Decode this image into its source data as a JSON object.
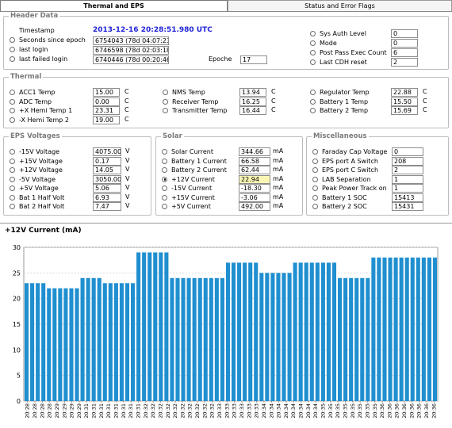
{
  "tabs": [
    {
      "label": "Thermal and EPS",
      "active": true
    },
    {
      "label": "Status and Error Flags",
      "active": false
    }
  ],
  "header": {
    "title": "Header Data",
    "timestamp_label": "Timestamp",
    "timestamp_value": "2013-12-16 20:28:51.980 UTC",
    "seconds_label": "Seconds since epoch",
    "seconds_value": "6754043 (78d 04:07:23)",
    "last_login_label": "last login",
    "last_login_value": "6746598 (78d 02:03:18)",
    "last_failed_label": "last failed login",
    "last_failed_value": "6740446 (78d 00:20:46)",
    "epoche_label": "Epoche",
    "epoche_value": "17",
    "sys_auth_label": "Sys Auth Level",
    "sys_auth_value": "0",
    "mode_label": "Mode",
    "mode_value": "0",
    "post_pass_label": "Post Pass Exec Count",
    "post_pass_value": "6",
    "last_cdh_label": "Last CDH reset",
    "last_cdh_value": "2"
  },
  "thermal": {
    "title": "Thermal",
    "unit": "C",
    "col1": [
      {
        "label": "ACC1 Temp",
        "value": "15.00"
      },
      {
        "label": "ADC Temp",
        "value": "0.00"
      },
      {
        "label": "+X Hemi Temp 1",
        "value": "23.31"
      },
      {
        "label": "-X Hemi Temp 2",
        "value": "19.00"
      }
    ],
    "col2": [
      {
        "label": "NMS Temp",
        "value": "13.94"
      },
      {
        "label": "Receiver Temp",
        "value": "16.25"
      },
      {
        "label": "Transmitter Temp",
        "value": "16.44"
      }
    ],
    "col3": [
      {
        "label": "Regulator Temp",
        "value": "22.88"
      },
      {
        "label": "Battery 1 Temp",
        "value": "15.50"
      },
      {
        "label": "Battery 2 Temp",
        "value": "15.69"
      }
    ]
  },
  "eps": {
    "title": "EPS Voltages",
    "unit": "V",
    "items": [
      {
        "label": "-15V Voltage",
        "value": "4075.00"
      },
      {
        "label": "+15V Voltage",
        "value": "0.17"
      },
      {
        "label": "+12V Voltage",
        "value": "14.05"
      },
      {
        "label": "-5V Voltage",
        "value": "3050.00"
      },
      {
        "label": "+5V Voltage",
        "value": "5.06"
      },
      {
        "label": "Bat 1 Half Volt",
        "value": "6.93"
      },
      {
        "label": "Bat 2 Half Volt",
        "value": "7.47"
      }
    ]
  },
  "solar": {
    "title": "Solar",
    "unit": "mA",
    "items": [
      {
        "label": "Solar Current",
        "value": "344.66",
        "selected": false
      },
      {
        "label": "Battery 1 Current",
        "value": "66.58",
        "selected": false
      },
      {
        "label": "Battery 2 Current",
        "value": "62.44",
        "selected": false
      },
      {
        "label": "+12V Current",
        "value": "22.94",
        "selected": true
      },
      {
        "label": "-15V Current",
        "value": "-18.30",
        "selected": false
      },
      {
        "label": "+15V Current",
        "value": "-3.06",
        "selected": false
      },
      {
        "label": "+5V Current",
        "value": "492.00",
        "selected": false
      }
    ]
  },
  "misc": {
    "title": "Miscellaneous",
    "items": [
      {
        "label": "Faraday Cap Voltage",
        "value": "0"
      },
      {
        "label": "EPS port A Switch",
        "value": "208"
      },
      {
        "label": "EPS port C Switch",
        "value": "2"
      },
      {
        "label": "LAB Separation",
        "value": "1"
      },
      {
        "label": "Peak Power Track on",
        "value": "1"
      },
      {
        "label": "Battery 1 SOC",
        "value": "15413"
      },
      {
        "label": "Battery 2 SOC",
        "value": "15431"
      }
    ]
  },
  "chart_data": {
    "type": "bar",
    "title": "+12V Current (mA)",
    "ylim": [
      0,
      30
    ],
    "yticks": [
      0,
      5,
      10,
      15,
      20,
      25,
      30
    ],
    "grid": true,
    "bar_color": "#1f8fd0",
    "categories": [
      "20:28",
      "20:28",
      "20:28",
      "20:28",
      "20:29",
      "20:29",
      "20:29",
      "20:29",
      "20:31",
      "20:31",
      "20:31",
      "20:31",
      "20:31",
      "20:31",
      "20:31",
      "20:31",
      "20:32",
      "20:32",
      "20:32",
      "20:32",
      "20:32",
      "20:32",
      "20:32",
      "20:32",
      "20:32",
      "20:32",
      "20:33",
      "20:33",
      "20:33",
      "20:33",
      "20:33",
      "20:33",
      "20:34",
      "20:34",
      "20:34",
      "20:34",
      "20:34",
      "20:34",
      "20:34",
      "20:34",
      "20:35",
      "20:35",
      "20:35",
      "20:35",
      "20:35",
      "20:35",
      "20:35",
      "20:35",
      "20:36",
      "20:36",
      "20:36",
      "20:36",
      "20:36",
      "20:36",
      "20:36",
      "20:36"
    ],
    "values": [
      23,
      23,
      23,
      23,
      22,
      22,
      22,
      22,
      22,
      22,
      24,
      24,
      24,
      24,
      23,
      23,
      23,
      23,
      23,
      23,
      29,
      29,
      29,
      29,
      29,
      29,
      24,
      24,
      24,
      24,
      24,
      24,
      24,
      24,
      24,
      24,
      27,
      27,
      27,
      27,
      27,
      27,
      25,
      25,
      25,
      25,
      25,
      25,
      27,
      27,
      27,
      27,
      27,
      27,
      27,
      27,
      24,
      24,
      24,
      24,
      24,
      24,
      28,
      28,
      28,
      28,
      28,
      28,
      28,
      28,
      28,
      28,
      28,
      28
    ]
  }
}
